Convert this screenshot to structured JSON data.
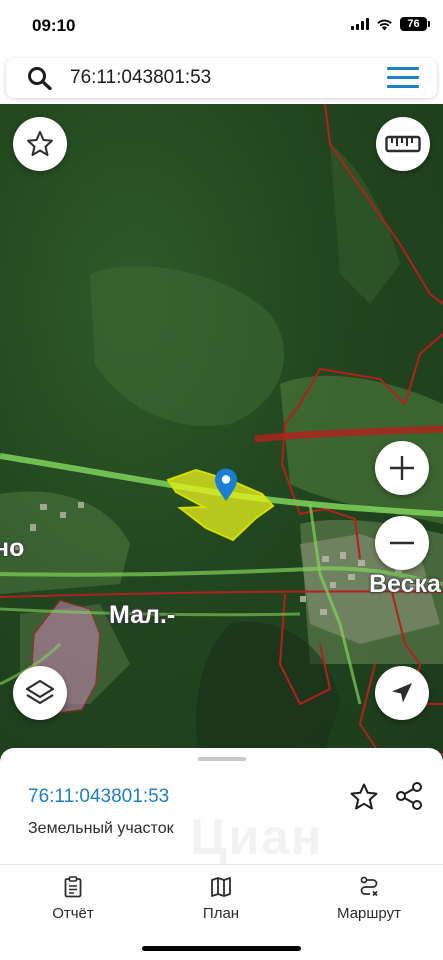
{
  "status_bar": {
    "time": "09:10",
    "battery": "76"
  },
  "search": {
    "value": "76:11:043801:53",
    "icon": "search-icon"
  },
  "map": {
    "labels": {
      "left_partial": "но",
      "village_right": "Веска",
      "village_small": "Мал.-"
    },
    "colors": {
      "parcel_fill": "#e8f21e",
      "boundary": "#b3201d",
      "road": "#7fd35a",
      "marker": "#1a7fd0"
    }
  },
  "sheet": {
    "parcel_id": "76:11:043801:53",
    "parcel_type": "Земельный участок",
    "watermark": "Циан"
  },
  "tabs": [
    {
      "label": "Отчёт",
      "icon": "report-icon"
    },
    {
      "label": "План",
      "icon": "map-plan-icon"
    },
    {
      "label": "Маршрут",
      "icon": "route-icon"
    }
  ]
}
